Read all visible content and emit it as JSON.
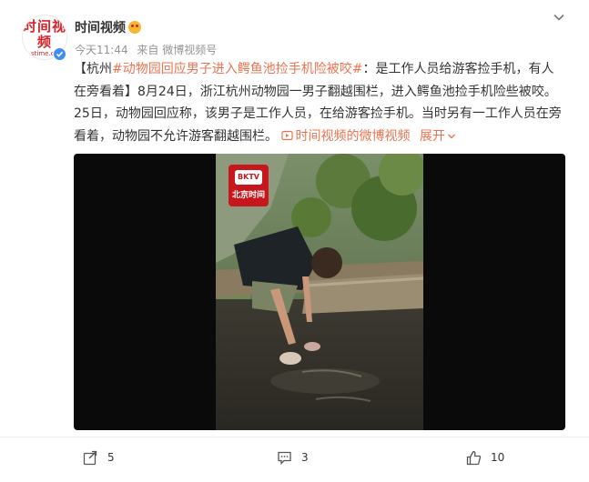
{
  "author": {
    "name": "时间视频",
    "avatar_text": "时间视频",
    "avatar_subtext": "stime.cn",
    "verified": true
  },
  "meta": {
    "time": "今天11:44",
    "source": "来自 微博视频号"
  },
  "post": {
    "bracket_open": "【杭州",
    "hashtag": "#动物园回应男子进入鳄鱼池捡手机险被咬#",
    "headline_rest": "：是工作人员给游客捡手机，有人在旁看着】",
    "body": "8月24日，浙江杭州动物园一男子翻越围栏，进入鳄鱼池捡手机险些被咬。25日，动物园回应称，该男子是工作人员，在给游客捡手机。当时另有一工作人员在旁看着，动物园不允许游客翻越围栏。",
    "source_link": "时间视频的微博视频",
    "expand_label": "展开"
  },
  "video": {
    "logo_top": "BKTV",
    "logo_bottom": "北京时间"
  },
  "actions": {
    "repost_count": "5",
    "comment_count": "3",
    "like_count": "10"
  },
  "colors": {
    "accent": "#eb7350",
    "verified_blue": "#3d8ff5",
    "brand_red": "#d8232a"
  }
}
